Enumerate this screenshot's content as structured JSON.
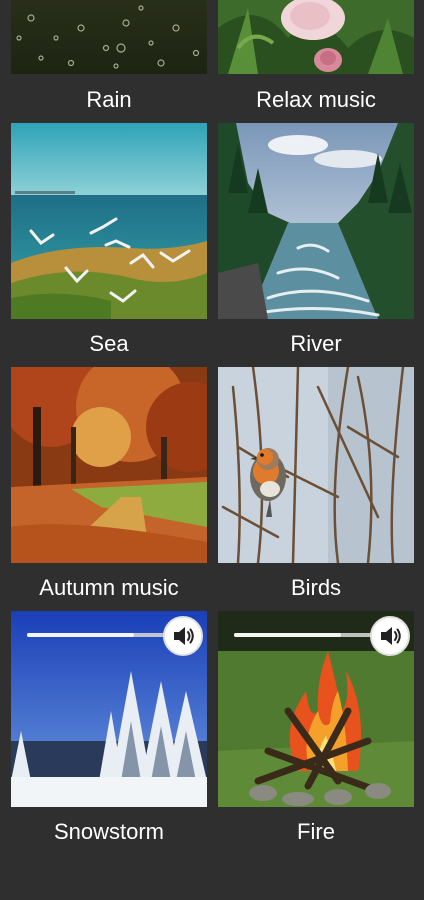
{
  "tiles": [
    {
      "label": "Rain",
      "art": "rain-drops-image"
    },
    {
      "label": "Relax music",
      "art": "roses-image"
    },
    {
      "label": "Sea",
      "art": "seagulls-sea-image"
    },
    {
      "label": "River",
      "art": "mountain-river-image"
    },
    {
      "label": "Autumn music",
      "art": "autumn-park-image"
    },
    {
      "label": "Birds",
      "art": "robin-bird-image"
    },
    {
      "label": "Snowstorm",
      "art": "snowy-forest-image",
      "playing": true,
      "volume_percent": 75
    },
    {
      "label": "Fire",
      "art": "campfire-image",
      "playing": true,
      "volume_percent": 75
    }
  ],
  "icons": {
    "volume": "speaker-volume-icon"
  },
  "colors": {
    "background": "#2f2f2f",
    "label_text": "#ffffff",
    "slider_track": "#d2d2d2",
    "volume_button": "#ffffff"
  }
}
